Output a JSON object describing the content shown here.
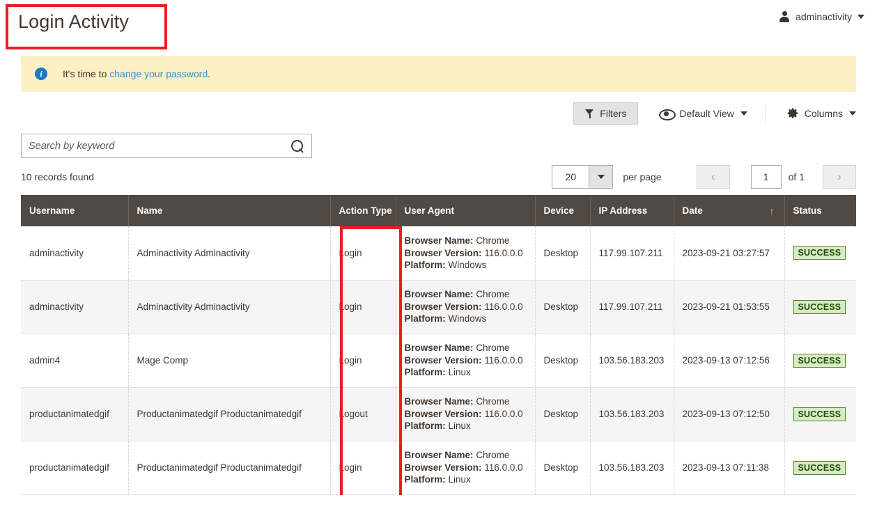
{
  "header": {
    "title": "Login Activity",
    "user_menu": {
      "name": "adminactivity",
      "icon": "user-icon"
    }
  },
  "notice": {
    "icon": "info-icon",
    "text_before": "It's time to ",
    "link_text": "change your password",
    "text_after": "."
  },
  "toolbar": {
    "filters_label": "Filters",
    "view_label": "Default View",
    "columns_label": "Columns"
  },
  "search": {
    "placeholder": "Search by keyword",
    "value": ""
  },
  "records": {
    "count_label": "10 records found"
  },
  "pagination": {
    "per_page_value": "20",
    "per_page_label": "per page",
    "prev_label": "‹",
    "next_label": "›",
    "current_page": "1",
    "of_label": "of 1"
  },
  "table": {
    "columns": [
      {
        "label": "Username",
        "sorted": false
      },
      {
        "label": "Name",
        "sorted": false
      },
      {
        "label": "Action Type",
        "sorted": false
      },
      {
        "label": "User Agent",
        "sorted": false
      },
      {
        "label": "Device",
        "sorted": false
      },
      {
        "label": "IP Address",
        "sorted": false
      },
      {
        "label": "Date",
        "sorted": true,
        "sort_arrow": "↑"
      },
      {
        "label": "Status",
        "sorted": false
      }
    ],
    "labels": {
      "browser_name": "Browser Name:",
      "browser_version": "Browser Version:",
      "platform": "Platform:"
    },
    "rows": [
      {
        "username": "adminactivity",
        "name": "Adminactivity Adminactivity",
        "action_type": "Login",
        "browser_name": "Chrome",
        "browser_version": "116.0.0.0",
        "platform": "Windows",
        "device": "Desktop",
        "ip_address": "117.99.107.211",
        "date": "2023-09-21 03:27:57",
        "status": "SUCCESS"
      },
      {
        "username": "adminactivity",
        "name": "Adminactivity Adminactivity",
        "action_type": "Login",
        "browser_name": "Chrome",
        "browser_version": "116.0.0.0",
        "platform": "Windows",
        "device": "Desktop",
        "ip_address": "117.99.107.211",
        "date": "2023-09-21 01:53:55",
        "status": "SUCCESS"
      },
      {
        "username": "admin4",
        "name": "Mage Comp",
        "action_type": "Login",
        "browser_name": "Chrome",
        "browser_version": "116.0.0.0",
        "platform": "Linux",
        "device": "Desktop",
        "ip_address": "103.56.183.203",
        "date": "2023-09-13 07:12:56",
        "status": "SUCCESS"
      },
      {
        "username": "productanimatedgif",
        "name": "Productanimatedgif Productanimatedgif",
        "action_type": "Logout",
        "browser_name": "Chrome",
        "browser_version": "116.0.0.0",
        "platform": "Linux",
        "device": "Desktop",
        "ip_address": "103.56.183.203",
        "date": "2023-09-13 07:12:50",
        "status": "SUCCESS"
      },
      {
        "username": "productanimatedgif",
        "name": "Productanimatedgif Productanimatedgif",
        "action_type": "Login",
        "browser_name": "Chrome",
        "browser_version": "116.0.0.0",
        "platform": "Linux",
        "device": "Desktop",
        "ip_address": "103.56.183.203",
        "date": "2023-09-13 07:11:38",
        "status": "SUCCESS"
      }
    ]
  },
  "annotations": {
    "title_box_color": "#ed1c24",
    "column_box_color": "#ed1c24"
  }
}
